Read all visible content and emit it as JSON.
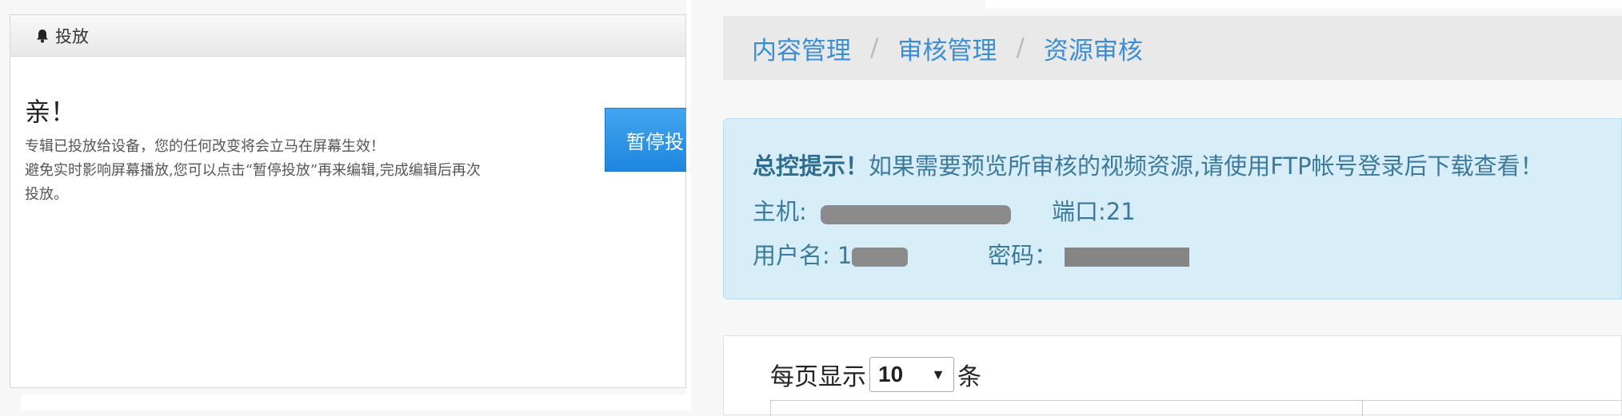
{
  "left_panel": {
    "header_title": "投放",
    "header_icon": "bell-icon",
    "greeting": "亲！",
    "notice_lines": [
      "专辑已投放给设备，您的任何改变将会立马在屏幕生效！",
      "避免实时影响屏幕播放,您可以点击“暂停投放”再来编辑,完成编辑后再次",
      "投放。"
    ],
    "pause_button_label": "暂停投"
  },
  "breadcrumb": {
    "items": [
      "内容管理",
      "审核管理",
      "资源审核"
    ],
    "separator": "/"
  },
  "ftp_notice": {
    "title": "总控提示！",
    "message": "如果需要预览所审核的视频资源,请使用FTP帐号登录后下载查看！",
    "host_label": "主机:",
    "port_label": "端口:21",
    "user_label": "用户名:",
    "user_partial": "1",
    "password_label": "密码："
  },
  "table_controls": {
    "prefix": "每页显示",
    "page_size": "10",
    "suffix": "条"
  },
  "colors": {
    "link": "#3a8ed6",
    "button": "#2a8fe6",
    "info_bg": "#d7edf7",
    "info_text": "#3b7a9c"
  }
}
